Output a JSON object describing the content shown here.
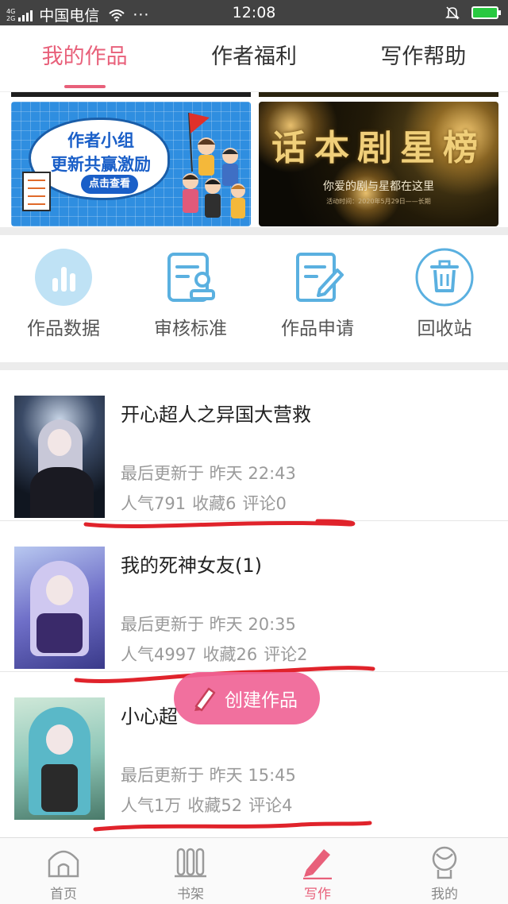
{
  "status_bar": {
    "network_top": "4G",
    "network_bottom": "2G",
    "carrier": "中国电信",
    "more": "···",
    "time": "12:08"
  },
  "top_tabs": [
    {
      "label": "我的作品",
      "active": true
    },
    {
      "label": "作者福利",
      "active": false
    },
    {
      "label": "写作帮助",
      "active": false
    }
  ],
  "banners": {
    "left": {
      "title_line1": "作者小组",
      "title_line2": "更新共赢激励",
      "button": "点击查看",
      "accent_color": "#2f8ee0"
    },
    "right": {
      "title": "话本剧星榜",
      "subtitle": "你爱的剧与星都在这里",
      "date_text": "活动时间：2020年5月29日——长期"
    }
  },
  "quick_actions": [
    {
      "label": "作品数据",
      "icon": "bar-chart-icon"
    },
    {
      "label": "审核标准",
      "icon": "review-stamp-icon"
    },
    {
      "label": "作品申请",
      "icon": "edit-document-icon"
    },
    {
      "label": "回收站",
      "icon": "trash-icon"
    }
  ],
  "works": [
    {
      "title": "开心超人之异国大营救",
      "updated": "最后更新于 昨天 22:43",
      "popularity": "人气791",
      "favorites": "收藏6",
      "comments": "评论0"
    },
    {
      "title": "我的死神女友(1)",
      "updated": "最后更新于 昨天 20:35",
      "popularity": "人气4997",
      "favorites": "收藏26",
      "comments": "评论2"
    },
    {
      "title": "小心超",
      "updated": "最后更新于 昨天 15:45",
      "popularity": "人气1万",
      "favorites": "收藏52",
      "comments": "评论4"
    }
  ],
  "fab": {
    "label": "创建作品",
    "color": "#f06496"
  },
  "bottom_nav": [
    {
      "label": "首页",
      "icon": "home-icon",
      "active": false
    },
    {
      "label": "书架",
      "icon": "bookshelf-icon",
      "active": false
    },
    {
      "label": "写作",
      "icon": "pen-icon",
      "active": true
    },
    {
      "label": "我的",
      "icon": "profile-icon",
      "active": false
    }
  ],
  "colors": {
    "accent": "#e8607a",
    "icon_blue": "#5ab0e0",
    "annotation_red": "#e0232b"
  }
}
